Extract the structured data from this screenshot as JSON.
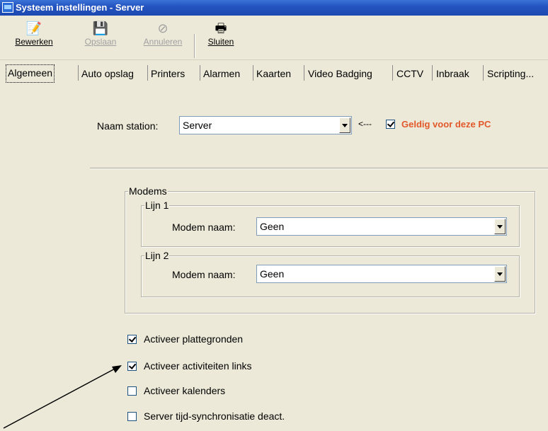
{
  "window": {
    "title": "Systeem instellingen - Server"
  },
  "toolbar": {
    "buttons": [
      {
        "label": "Bewerken",
        "icon": "edit-document-icon",
        "enabled": true
      },
      {
        "label": "Opslaan",
        "icon": "save-document-icon",
        "enabled": false
      },
      {
        "label": "Annuleren",
        "icon": "cancel-icon",
        "enabled": false
      },
      {
        "label": "Sluiten",
        "icon": "close-printer-icon",
        "enabled": true
      }
    ]
  },
  "tabs": [
    {
      "label": "Algemeen",
      "active": true
    },
    {
      "label": "Auto opslag"
    },
    {
      "label": "Printers"
    },
    {
      "label": "Alarmen"
    },
    {
      "label": "Kaarten"
    },
    {
      "label": "Video Badging"
    },
    {
      "label": "CCTV"
    },
    {
      "label": "Inbraak"
    },
    {
      "label": "Scripting..."
    }
  ],
  "station": {
    "label": "Naam station:",
    "value": "Server",
    "arrow_text": "<---",
    "valid_label": "Geldig voor deze PC",
    "valid_checked": true
  },
  "modems": {
    "title": "Modems",
    "lines": [
      {
        "title": "Lijn 1",
        "label": "Modem naam:",
        "value": "Geen"
      },
      {
        "title": "Lijn 2",
        "label": "Modem naam:",
        "value": "Geen"
      }
    ]
  },
  "options": [
    {
      "label": "Activeer plattegronden",
      "checked": true
    },
    {
      "label": "Activeer activiteiten links",
      "checked": true
    },
    {
      "label": "Activeer kalenders",
      "checked": false
    },
    {
      "label": "Server tijd-synchronisatie deact.",
      "checked": false
    }
  ],
  "colors": {
    "titlebar": "#2454c0",
    "accent_orange": "#e2582a",
    "window_bg": "#ece9d8"
  }
}
